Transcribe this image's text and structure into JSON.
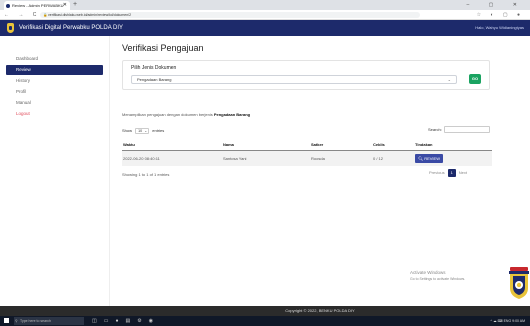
{
  "browser": {
    "tab_title": "Review - Admin PERWABKU",
    "url": "verifikasi.dishlaku.web.id/admin/review/kd/dokumen/2",
    "new_tab": "+",
    "window_controls": "– ▢ ✕",
    "nav_icons": "← → C",
    "tool_icons": "☆ ◐ ▢ ●"
  },
  "app": {
    "brand": "Verifikasi Digital Perwabku POLDA DIY",
    "user": "Halo, Wahyu Widianingtyas",
    "accent": "#1d2a6b"
  },
  "sidebar": {
    "items": [
      {
        "label": "Dashboard"
      },
      {
        "label": "Review"
      },
      {
        "label": "History"
      },
      {
        "label": "Profil"
      },
      {
        "label": "Manual"
      },
      {
        "label": "Logout"
      }
    ]
  },
  "main": {
    "title": "Verifikasi Pengajuan",
    "card": {
      "label": "Pilih Jenis Dokumen",
      "selected": "Pengadaan Barang",
      "go": "GO"
    },
    "info_prefix": "Menampilkan pengajuan dengan dokumen berjenis ",
    "info_bold": "Pengadaan Barang",
    "length": {
      "show": "Show",
      "value": "10",
      "entries": "entries"
    },
    "search_label": "Search:",
    "table": {
      "headers": [
        "Waktu",
        "Nama",
        "Satker",
        "Ceklis",
        "Tindakan"
      ],
      "rows": [
        {
          "waktu": "2022-06-20 08:40:11",
          "nama": "Santosa Yani",
          "satker": "Roosda",
          "ceklis": "0 / 12",
          "action": "REVIEW"
        }
      ]
    },
    "showing": "Showing 1 to 1 of 1 entries",
    "pager": {
      "prev": "Previous",
      "current": "1",
      "next": "Next"
    }
  },
  "watermark": {
    "line1": "Activate Windows",
    "line2": "Go to Settings to activate Windows."
  },
  "footer": "Copyright © 2022, BENKU POLDA DIY",
  "taskbar": {
    "search_placeholder": "Type here to search",
    "tray": "^ ☁ ⌨ ENG 9:00 AM"
  }
}
